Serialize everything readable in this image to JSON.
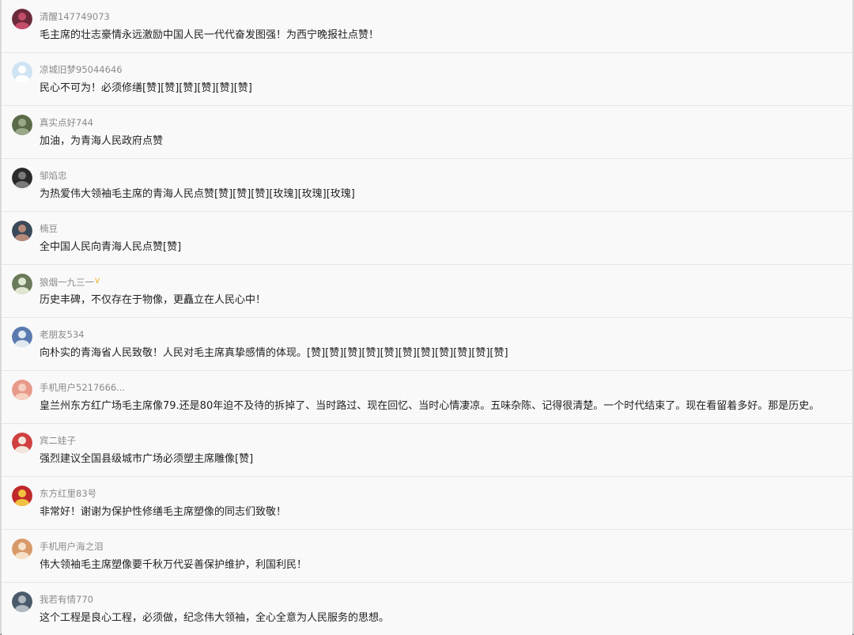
{
  "comments": [
    {
      "username": "清醒147749073",
      "text": "毛主席的壮志豪情永远激励中国人民一代代奋发图强！为西宁晚报社点赞！",
      "avatar_colors": [
        "#6b2a3a",
        "#c44d6a"
      ]
    },
    {
      "username": "凉城旧梦95044646",
      "text": "民心不可为！必须修缮[赞][赞][赞][赞][赞][赞]",
      "avatar_colors": [
        "#cfe3f2",
        "#ffffff"
      ]
    },
    {
      "username": "真实点好744",
      "text": "加油，为青海人民政府点赞",
      "avatar_colors": [
        "#5a6b4a",
        "#9aa88a"
      ]
    },
    {
      "username": "邹焰忠",
      "text": "为热爱伟大领袖毛主席的青海人民点赞[赞][赞][赞][玫瑰][玫瑰][玫瑰]",
      "avatar_colors": [
        "#2a2a2a",
        "#7a7a7a"
      ]
    },
    {
      "username": "楠豆",
      "text": "全中国人民向青海人民点赞[赞]",
      "avatar_colors": [
        "#3a4a5a",
        "#b58a7a"
      ]
    },
    {
      "username": "狼烟一九三一",
      "vip": "V",
      "text": "历史丰碑，不仅存在于物像，更矗立在人民心中！",
      "avatar_colors": [
        "#6a7a5a",
        "#dfe6d0"
      ]
    },
    {
      "username": "老朋友534",
      "text": "向朴实的青海省人民致敬！人民对毛主席真挚感情的体现。[赞][赞][赞][赞][赞][赞][赞][赞][赞][赞][赞]",
      "avatar_colors": [
        "#5a7ab0",
        "#e0e8f0"
      ]
    },
    {
      "username": "手机用户5217666...",
      "text": "皇兰州东方红广场毛主席像79.还是80年迫不及待的拆掉了、当时路过、现在回忆、当时心情凄凉。五味杂陈、记得很清楚。一个时代结束了。现在看留着多好。那是历史。",
      "avatar_colors": [
        "#e89a8a",
        "#f6d0c0"
      ]
    },
    {
      "username": "宾二娃子",
      "text": "强烈建议全国县级城市广场必须塑主席雕像[赞]",
      "avatar_colors": [
        "#d04040",
        "#f3e6dc"
      ]
    },
    {
      "username": "东方红里83号",
      "text": "非常好！谢谢为保护性修缮毛主席塑像的同志们致敬！",
      "avatar_colors": [
        "#c0282a",
        "#f2c040"
      ]
    },
    {
      "username": "手机用户海之泪",
      "text": "伟大领袖毛主席塑像要千秋万代妥善保护维护，利国利民！",
      "avatar_colors": [
        "#d89a6a",
        "#f6e0c8"
      ]
    },
    {
      "username": "我若有情770",
      "text": "这个工程是良心工程，必须做，纪念伟大领袖，全心全意为人民服务的思想。",
      "avatar_colors": [
        "#4a5a6a",
        "#b0b8c0"
      ]
    }
  ]
}
